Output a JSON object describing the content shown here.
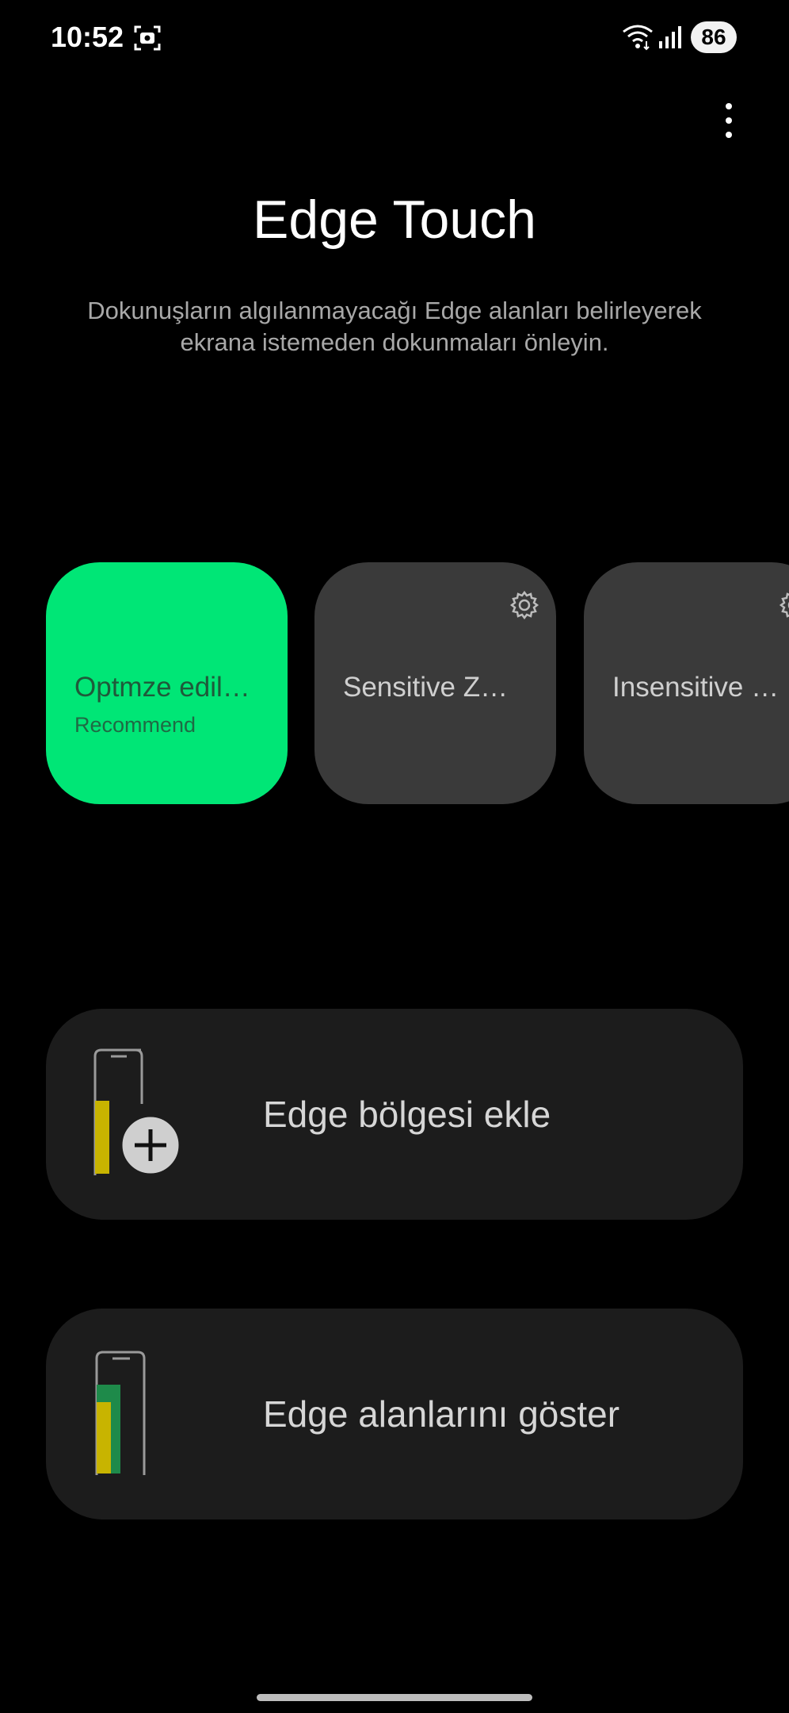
{
  "status_bar": {
    "time": "10:52",
    "battery": "86",
    "icons": [
      "screenshot-icon",
      "wifi-icon",
      "signal-icon"
    ]
  },
  "header": {
    "title": "Edge Touch",
    "description": "Dokunuşların algılanmayacağı Edge alanları belirleyerek ekrana istemeden dokunmaları önleyin."
  },
  "modes": [
    {
      "label": "Optmze edil…",
      "sublabel": "Recommend",
      "selected": true
    },
    {
      "label": "Sensitive Z…",
      "selected": false
    },
    {
      "label": "Insensitive …",
      "selected": false
    }
  ],
  "actions": {
    "add_zone": "Edge bölgesi ekle",
    "show_zones": "Edge alanlarını göster"
  },
  "colors": {
    "accent": "#00e676",
    "card": "#3a3a3a",
    "row": "#1c1c1c",
    "zone_yellow": "#c8b400",
    "zone_green": "#1e8a4a"
  }
}
